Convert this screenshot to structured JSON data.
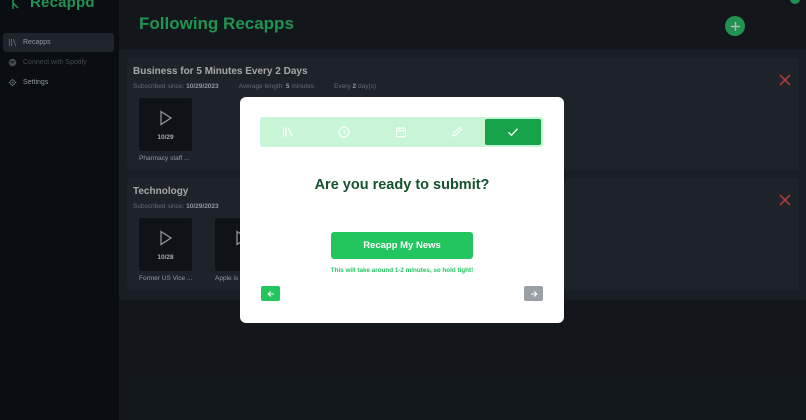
{
  "app": {
    "name": "Recappd"
  },
  "sidebar": {
    "items": [
      {
        "label": "Recapps",
        "icon": "library-icon",
        "active": true
      },
      {
        "label": "Connect with Spotify",
        "icon": "spotify-icon",
        "disabled": true
      },
      {
        "label": "Settings",
        "icon": "gear-icon"
      }
    ]
  },
  "header": {
    "title": "Following Recapps",
    "add_icon": "plus-icon"
  },
  "cards": [
    {
      "title": "Business for 5 Minutes Every 2 Days",
      "subscribed_label": "Subscribed since:",
      "subscribed_date": "10/29/2023",
      "length_label": "Average length:",
      "length_value": "5",
      "length_unit": "minutes",
      "freq_prefix": "Every",
      "freq_value": "2",
      "freq_suffix": "day(s)",
      "episodes": [
        {
          "date": "10/29",
          "label": "Pharmacy staff ..."
        }
      ]
    },
    {
      "title": "Technology",
      "subscribed_label": "Subscribed since:",
      "subscribed_date": "10/29/2023",
      "episodes": [
        {
          "date": "10/28",
          "label": "Former US Vice ..."
        },
        {
          "date": "",
          "label": "Apple is"
        }
      ]
    }
  ],
  "modal": {
    "steps": [
      "library-icon",
      "clock-icon",
      "calendar-icon",
      "pencil-icon",
      "check-icon"
    ],
    "active_step": 4,
    "heading": "Are you ready to submit?",
    "submit_label": "Recapp My News",
    "hint": "This will take around 1-2 minutes, so hold tight!",
    "prev_icon": "arrow-left-icon",
    "next_icon": "arrow-right-icon"
  },
  "colors": {
    "accent": "#2ecc71",
    "accent_dark": "#16a34a",
    "danger": "#e5534b",
    "heading": "#14532d",
    "steps_bg": "#c8f5d6"
  }
}
